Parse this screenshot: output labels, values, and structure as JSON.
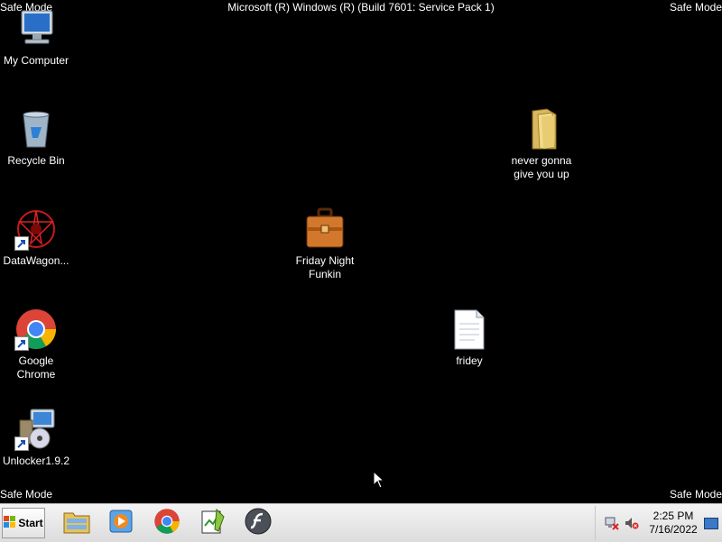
{
  "watermark": {
    "corner_text": "Safe Mode",
    "top_center": "Microsoft (R) Windows (R) (Build 7601: Service Pack 1)"
  },
  "desktop_icons": [
    {
      "label": "My Computer",
      "icon": "computer-icon"
    },
    {
      "label": "Recycle Bin",
      "icon": "recycle-bin-icon"
    },
    {
      "label": "DataWagon...",
      "icon": "datawagon-icon",
      "shortcut": true
    },
    {
      "label": "Google Chrome",
      "icon": "chrome-icon",
      "shortcut": true
    },
    {
      "label": "Unlocker1.9.2",
      "icon": "unlocker-icon",
      "shortcut": true
    },
    {
      "label": "never gonna give you up",
      "icon": "folder-icon"
    },
    {
      "label": "Friday Night Funkin",
      "icon": "briefcase-icon"
    },
    {
      "label": "fridey",
      "icon": "text-file-icon"
    }
  ],
  "taskbar": {
    "start_label": "Start",
    "pinned": [
      "file-explorer-icon",
      "media-player-icon",
      "chrome-icon",
      "notepadpp-icon",
      "flash-icon"
    ],
    "clock_time": "2:25 PM",
    "clock_date": "7/16/2022"
  }
}
